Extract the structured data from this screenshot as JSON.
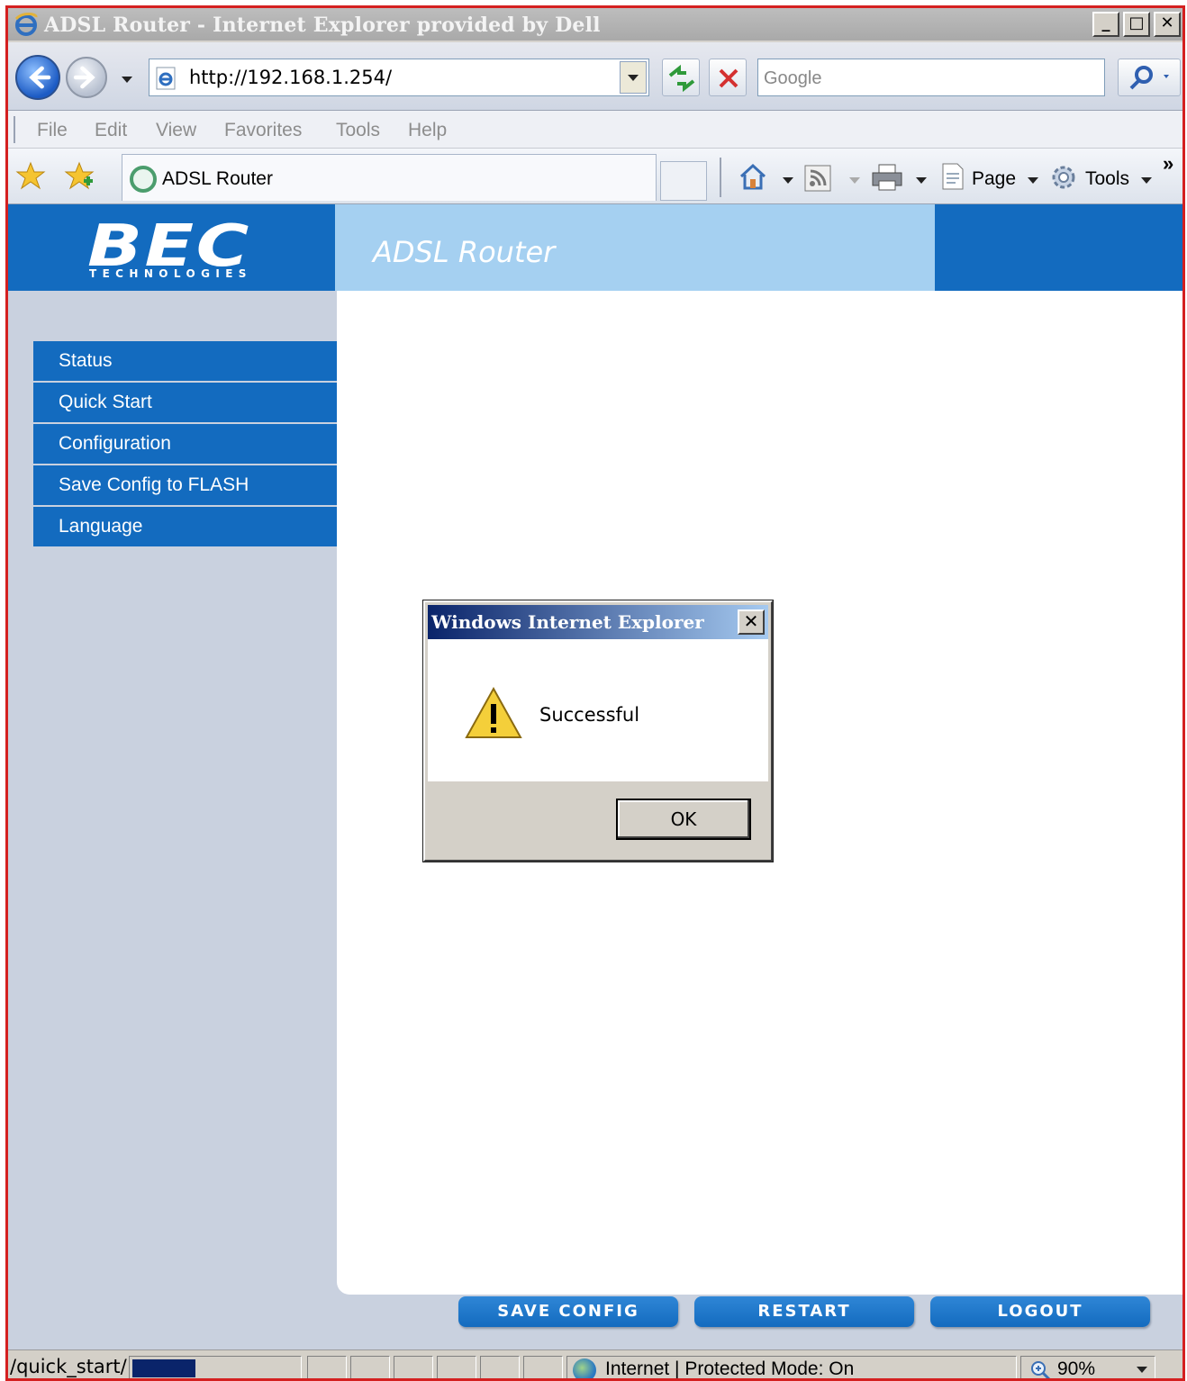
{
  "window": {
    "title": "ADSL Router - Internet Explorer provided by Dell",
    "buttons": {
      "minimize": "_",
      "maximize": "□",
      "close": "✕"
    }
  },
  "address_bar": {
    "url": "http://192.168.1.254/",
    "search_placeholder": "Google"
  },
  "menu": [
    "File",
    "Edit",
    "View",
    "Favorites",
    "Tools",
    "Help"
  ],
  "command_bar": {
    "tab_label": "ADSL Router",
    "page_label": "Page",
    "tools_label": "Tools",
    "more": "»"
  },
  "header": {
    "logo": "BEC",
    "logo_sub": "TECHNOLOGIES",
    "title": "ADSL Router"
  },
  "sidebar": {
    "items": [
      "Status",
      "Quick Start",
      "Configuration",
      "Save Config to FLASH",
      "Language"
    ]
  },
  "footer_buttons": {
    "save_config": "SAVE CONFIG",
    "restart": "RESTART",
    "logout": "LOGOUT"
  },
  "dialog": {
    "title": "Windows Internet Explorer",
    "message": "Successful",
    "ok": "OK",
    "close": "✕"
  },
  "statusbar": {
    "path": "/quick_start/",
    "zone": "Internet | Protected Mode: On",
    "zoom": "90%"
  },
  "colors": {
    "brand_blue": "#136bbf",
    "header_light": "#a5d0f1",
    "sidebar_bg": "#c9d1df"
  }
}
